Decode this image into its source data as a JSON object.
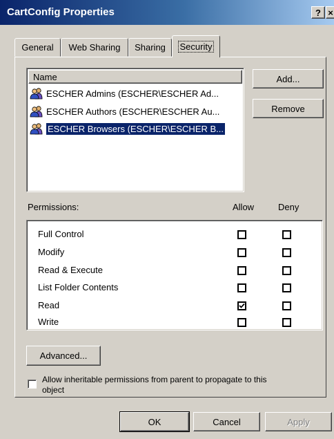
{
  "window": {
    "title": "CartConfig Properties",
    "help_label": "?",
    "close_label": "×"
  },
  "tabs": [
    {
      "label": "General",
      "active": false
    },
    {
      "label": "Web Sharing",
      "active": false
    },
    {
      "label": "Sharing",
      "active": false
    },
    {
      "label": "Security",
      "active": true
    }
  ],
  "names": {
    "header": "Name",
    "items": [
      {
        "label": "ESCHER Admins (ESCHER\\ESCHER Ad...",
        "selected": false,
        "icon": "user-group-icon"
      },
      {
        "label": "ESCHER Authors (ESCHER\\ESCHER Au...",
        "selected": false,
        "icon": "user-group-icon"
      },
      {
        "label": "ESCHER Browsers (ESCHER\\ESCHER B...",
        "selected": true,
        "icon": "user-group-icon"
      }
    ]
  },
  "buttons": {
    "add": "Add...",
    "remove": "Remove",
    "advanced": "Advanced...",
    "ok": "OK",
    "cancel": "Cancel",
    "apply": "Apply"
  },
  "permissions": {
    "label": "Permissions:",
    "allow_header": "Allow",
    "deny_header": "Deny",
    "rows": [
      {
        "label": "Full Control",
        "allow": false,
        "deny": false
      },
      {
        "label": "Modify",
        "allow": false,
        "deny": false
      },
      {
        "label": "Read & Execute",
        "allow": false,
        "deny": false
      },
      {
        "label": "List Folder Contents",
        "allow": false,
        "deny": false
      },
      {
        "label": "Read",
        "allow": true,
        "deny": false
      },
      {
        "label": "Write",
        "allow": false,
        "deny": false
      }
    ]
  },
  "inherit": {
    "label_line1": "Allow inheritable permissions from parent to propagate to this",
    "label_line2": "object",
    "checked": false
  },
  "colors": {
    "title_bar": "#0a246a",
    "selection": "#0a246a",
    "face": "#d4d0c8"
  }
}
